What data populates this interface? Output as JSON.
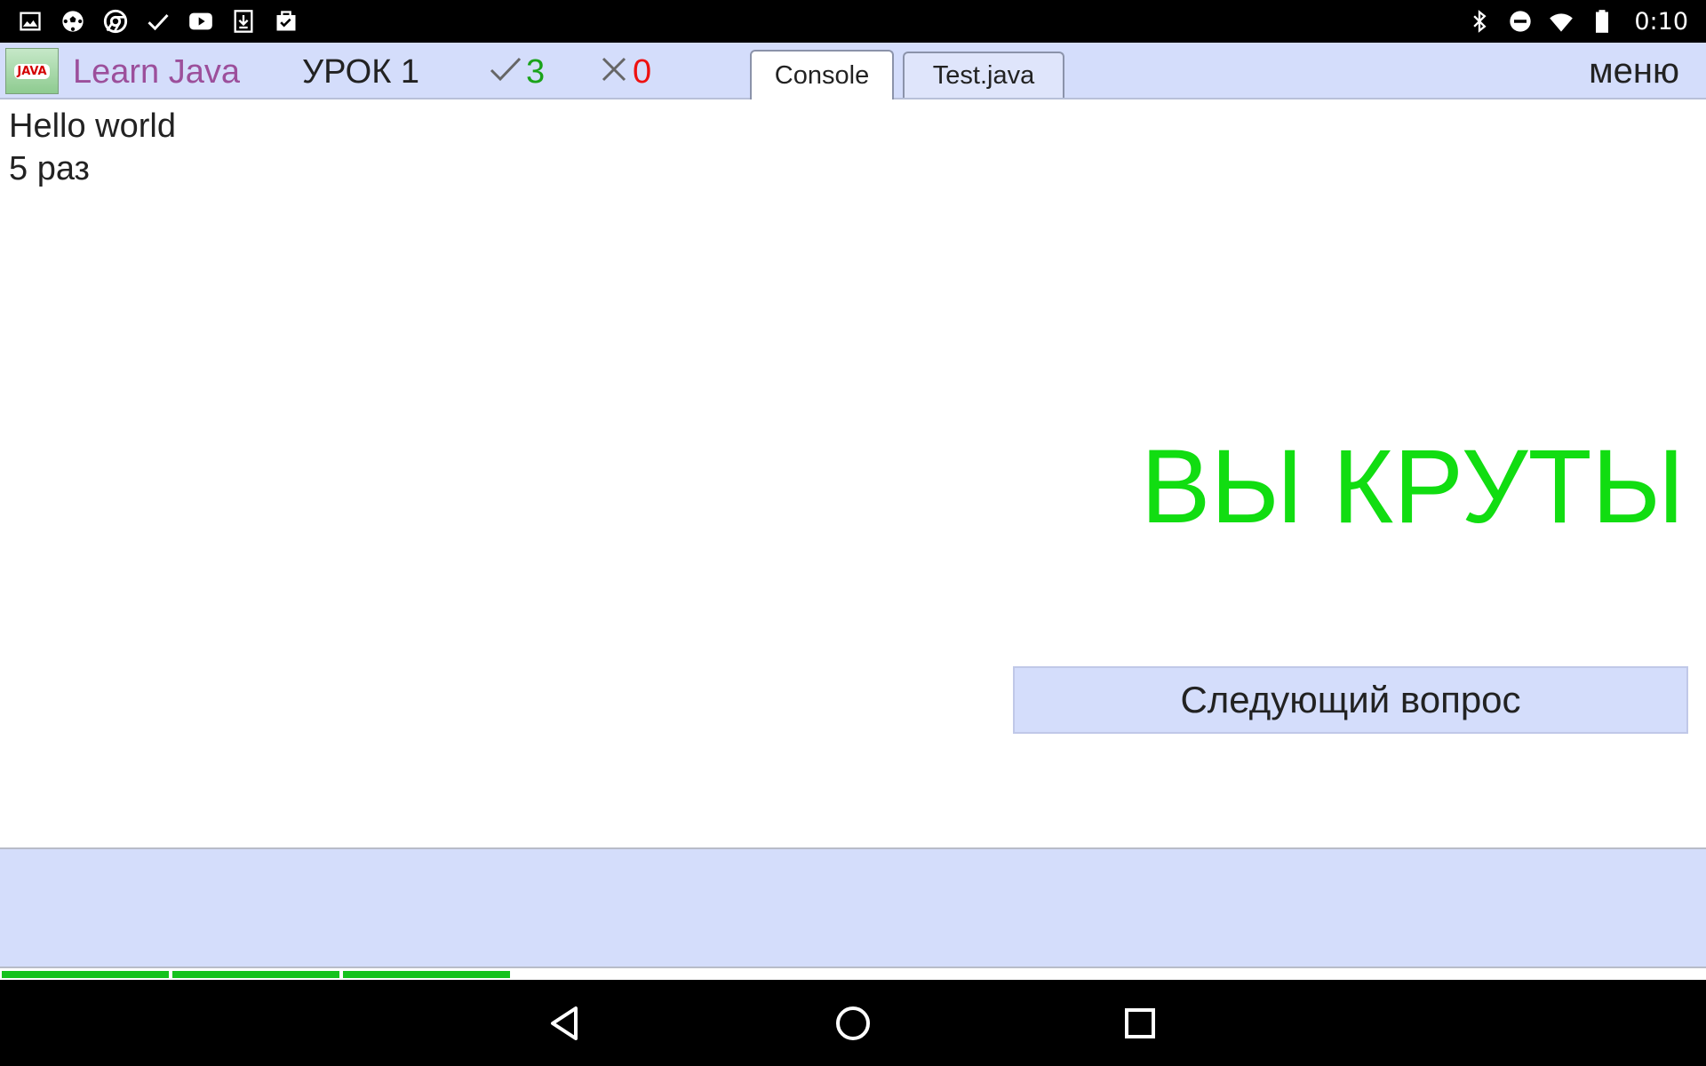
{
  "status_bar": {
    "left_icons": [
      "image-icon",
      "soccer-ball-icon",
      "chrome-icon",
      "check-icon",
      "youtube-icon",
      "download-icon",
      "clipboard-check-icon"
    ],
    "right_icons": [
      "bluetooth-icon",
      "do-not-disturb-icon",
      "wifi-icon",
      "battery-icon"
    ],
    "time": "0:10"
  },
  "header": {
    "logo_text": "JAVA",
    "app_title": "Learn Java",
    "lesson": "УРОК 1",
    "correct_count": "3",
    "wrong_count": "0",
    "tabs": [
      {
        "label": "Console",
        "active": true
      },
      {
        "label": "Test.java",
        "active": false
      }
    ],
    "menu_label": "меню"
  },
  "console": {
    "lines": [
      "Hello world",
      "5 раз"
    ]
  },
  "result": {
    "message": "ВЫ КРУТЫ"
  },
  "next_button": {
    "label": "Следующий вопрос"
  },
  "progress": {
    "completed_segments": 3
  },
  "colors": {
    "header_bg": "#d4ddfb",
    "title": "#9c4f9b",
    "correct": "#1aa31a",
    "wrong": "#ee1111",
    "success": "#11dd11",
    "progress": "#16c21e"
  },
  "navigation": {
    "buttons": [
      "back-icon",
      "home-icon",
      "recents-icon"
    ]
  }
}
